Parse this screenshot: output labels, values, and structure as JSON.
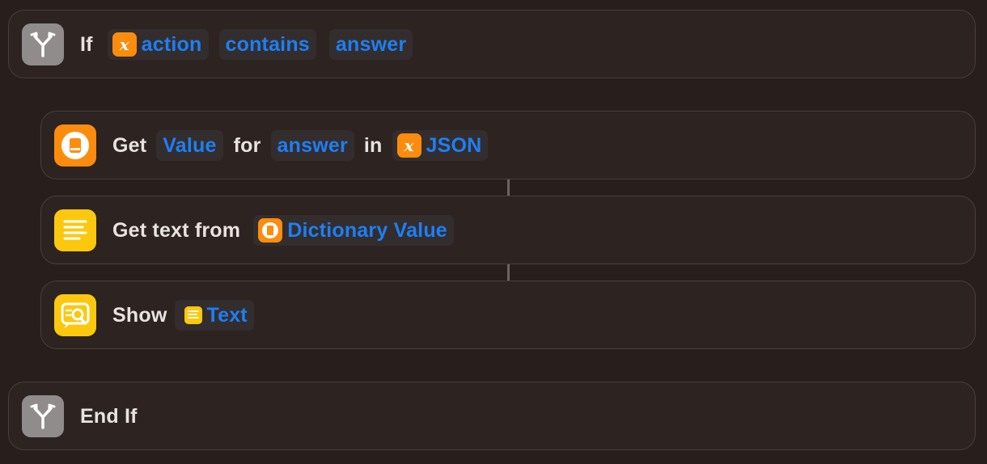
{
  "blocks": {
    "if_block": {
      "keyword": "If",
      "variable": "action",
      "operator": "contains",
      "value": "answer",
      "icon": "branch-icon"
    },
    "get_value": {
      "verb": "Get",
      "key_type": "Value",
      "for_word": "for",
      "key": "answer",
      "in_word": "in",
      "source": "JSON",
      "icon": "dictionary-icon"
    },
    "get_text": {
      "verb": "Get text from",
      "input": "Dictionary Value",
      "icon": "text-lines-icon"
    },
    "show": {
      "verb": "Show",
      "input": "Text",
      "icon": "show-result-icon"
    },
    "end_if": {
      "label": "End If",
      "icon": "branch-icon"
    }
  },
  "colors": {
    "background": "#281e1b",
    "card": "#2d2320",
    "token_text": "#1d7ff4",
    "orange": "#fc8c0d",
    "yellow": "#fcc80e",
    "gray": "#8f8c8b"
  }
}
